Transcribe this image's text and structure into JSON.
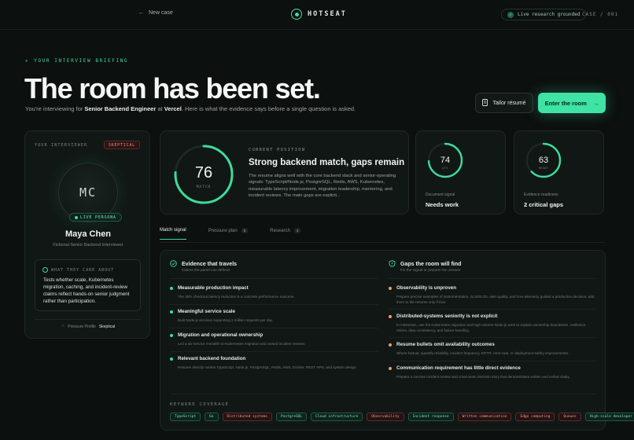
{
  "topbar": {
    "back_label": "New case",
    "brand": "HOTSEAT",
    "live_badge": "Live research grounded",
    "case_label": "CASE / 001"
  },
  "hero": {
    "eyebrow": "YOUR INTERVIEW BRIEFING",
    "title": "The room has been set.",
    "subtitle_pre": "You're interviewing for ",
    "role": "Senior Backend Engineer",
    "subtitle_mid": " at ",
    "company": "Vercel",
    "subtitle_post": ". Here is what the evidence says before a single question is asked.",
    "tailor_label": "Tailor résumé",
    "enter_label": "Enter the room"
  },
  "interviewer": {
    "label": "YOUR INTERVIEWER",
    "stance": "SKEPTICAL",
    "initials": "MC",
    "live": "LIVE PERSONA",
    "name": "Maya Chen",
    "role": "Fictional Senior Backend Interviewer",
    "care_heading": "WHAT THEY CARE ABOUT",
    "care_text": "Tests whether scale, Kubernetes migration, caching, and incident-review claims reflect hands-on senior judgment rather than participation.",
    "pressure_label": "Pressure Profile",
    "pressure_value": "Skeptical"
  },
  "position": {
    "score": "76",
    "score_label": "MATCH",
    "score_fraction": 0.76,
    "eyebrow": "CURRENT POSITION",
    "title": "Strong backend match, gaps remain",
    "text": "The resume aligns well with the core backend stack and senior-operating signals: TypeScript/Node.js, PostgreSQL, Redis, AWS, Kubernetes, measurable latency improvement, migration leadership, mentoring, and incident reviews. The main gaps are explicit..."
  },
  "metrics": [
    {
      "value": "74",
      "sub": "ATS",
      "fraction": 0.74,
      "label": "Document signal",
      "verdict": "Needs work"
    },
    {
      "value": "63",
      "sub": "READY",
      "fraction": 0.63,
      "label": "Evidence readiness",
      "verdict": "2 critical gaps"
    }
  ],
  "tabs": [
    {
      "label": "Match signal",
      "count": ""
    },
    {
      "label": "Pressure plan",
      "count": "5"
    },
    {
      "label": "Research",
      "count": "3"
    }
  ],
  "evidence": {
    "left_heading": "Evidence that travels",
    "left_sub": "Claims the panel can defend",
    "right_heading": "Gaps the room will find",
    "right_sub": "Fix the signal or prepare the answer",
    "travels": [
      {
        "title": "Measurable production impact",
        "desc": "The 38% checkout latency reduction is a concrete performance outcome."
      },
      {
        "title": "Meaningful service scale",
        "desc": "Built Node.js services supporting 2 million requests per day."
      },
      {
        "title": "Migration and operational ownership",
        "desc": "Led a six-service monolith-to-Kubernetes migration and owned incident reviews."
      },
      {
        "title": "Relevant backend foundation",
        "desc": "Resume directly names TypeScript, Node.js, PostgreSQL, Redis, AWS, Docker, REST APIs, and system design."
      }
    ],
    "gaps": [
      {
        "title": "Observability is unproven",
        "desc": "Prepare precise examples of instrumentation, SLIs/SLOs, alert quality, and how telemetry guided a production decision; add them to the resume only if true."
      },
      {
        "title": "Distributed-systems seniority is not explicit",
        "desc": "In interviews, use the Kubernetes migration and high-volume Node.js work to explain ownership boundaries, resilience, retries, data consistency, and failure handling."
      },
      {
        "title": "Resume bullets omit availability outcomes",
        "desc": "Where factual, quantify reliability, incident frequency, MTTR, error-rate, or deployment-safety improvements."
      },
      {
        "title": "Communication requirement has little direct evidence",
        "desc": "Prepare a concise incident review and cross-team decision story that demonstrates written and verbal clarity."
      }
    ],
    "keyword_heading": "KEYWORD COVERAGE",
    "keywords": [
      {
        "label": "TypeScript",
        "hit": true
      },
      {
        "label": "Go",
        "hit": true
      },
      {
        "label": "Distributed systems",
        "hit": false
      },
      {
        "label": "PostgreSQL",
        "hit": true
      },
      {
        "label": "Cloud infrastructure",
        "hit": true
      },
      {
        "label": "Observability",
        "hit": false
      },
      {
        "label": "Incident response",
        "hit": true
      },
      {
        "label": "Written communication",
        "hit": false
      },
      {
        "label": "Edge computing",
        "hit": false
      },
      {
        "label": "Queues",
        "hit": false
      },
      {
        "label": "High-scale developer platforms",
        "hit": true
      }
    ]
  },
  "colors": {
    "accent": "#3ddc9a",
    "danger": "#ff8a7a",
    "warn": "#ff9a57",
    "bg": "#0c100f"
  }
}
